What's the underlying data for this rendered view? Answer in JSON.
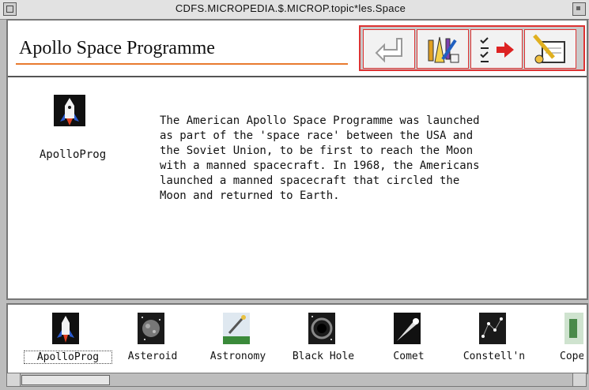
{
  "window": {
    "title": "CDFS.MICROPEDIA.$.MICROP.topic*les.Space"
  },
  "page": {
    "title": "Apollo Space Programme"
  },
  "toolbar": {
    "buttons": [
      {
        "name": "back",
        "icon": "back-arrow-icon"
      },
      {
        "name": "tools",
        "icon": "pens-ruler-icon"
      },
      {
        "name": "checklist-forward",
        "icon": "checklist-arrow-icon"
      },
      {
        "name": "notes",
        "icon": "pencil-notepad-icon"
      }
    ],
    "accent": "#dd3333"
  },
  "main_icon": {
    "label": "ApolloProg",
    "icon": "rocket-icon"
  },
  "article": {
    "text": "The American Apollo Space Programme was launched\nas part of the 'space race' between the USA and\nthe Soviet Union, to be first to reach the Moon\nwith a manned spacecraft. In 1968, the Americans\nlaunched a manned spacecraft that circled the\nMoon and returned to Earth."
  },
  "strip": {
    "items": [
      {
        "label": "ApolloProg",
        "icon": "rocket-icon",
        "selected": true
      },
      {
        "label": "Asteroid",
        "icon": "asteroid-icon",
        "selected": false
      },
      {
        "label": "Astronomy",
        "icon": "astronomy-icon",
        "selected": false
      },
      {
        "label": "Black Hole",
        "icon": "black-hole-icon",
        "selected": false
      },
      {
        "label": "Comet",
        "icon": "comet-icon",
        "selected": false
      },
      {
        "label": "Constell'n",
        "icon": "constellation-icon",
        "selected": false
      },
      {
        "label": "Cope",
        "icon": "generic-icon",
        "selected": false
      }
    ]
  }
}
